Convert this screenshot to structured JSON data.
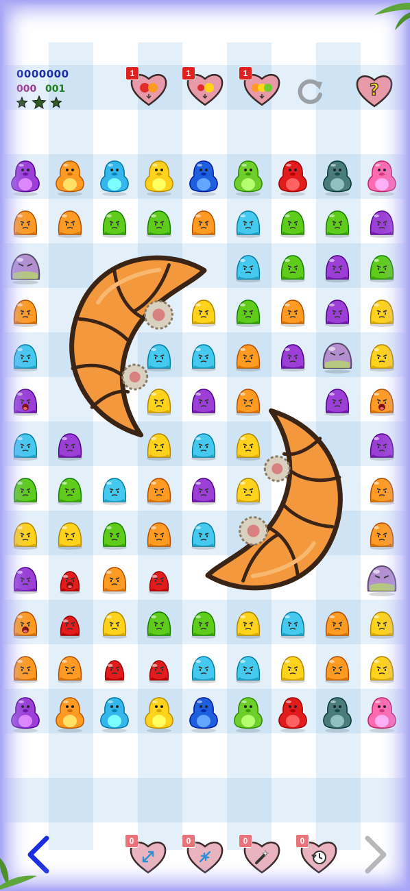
{
  "hud": {
    "score": "0000000",
    "moves": "000",
    "goal": "001",
    "stars": 3,
    "colors": {
      "score": "#1c2ca8",
      "moves": "#9a3a8a",
      "goal": "#1e7d1e",
      "star": "#2f5a22"
    }
  },
  "powerups": [
    {
      "name": "two-blob-combo",
      "count": "1",
      "blobs": [
        "red",
        "orange"
      ]
    },
    {
      "name": "two-blob-combo-2",
      "count": "1",
      "blobs": [
        "red",
        "yellow"
      ]
    },
    {
      "name": "three-blob-combo",
      "count": "1",
      "blobs": [
        "orange",
        "yellow",
        "green"
      ]
    }
  ],
  "controls": {
    "restart_icon": "refresh-icon",
    "help_label": "?"
  },
  "boosters": [
    {
      "name": "expand-booster",
      "count": "0",
      "icon": "expand-arrows-icon"
    },
    {
      "name": "shrink-booster",
      "count": "0",
      "icon": "shrink-arrows-icon"
    },
    {
      "name": "magic-wand-booster",
      "count": "0",
      "icon": "magic-wand-icon"
    },
    {
      "name": "undo-booster",
      "count": "0",
      "icon": "undo-clock-icon"
    }
  ],
  "nav": {
    "prev_icon": "chevron-left-icon",
    "next_icon": "chevron-right-icon",
    "prev_color": "#1a2ee0",
    "next_color": "#b8b8b8"
  },
  "palette": {
    "purple": "#9b3fd6",
    "orange": "#ff9b22",
    "cyan": "#36b7ec",
    "yellow": "#ffd21c",
    "blue": "#1e5fe0",
    "green": "#6fcf2a",
    "red": "#e21c1c",
    "teal": "#4b7c7c",
    "pink": "#ff6ab0",
    "lime": "#5fcc1c",
    "lightblue": "#46c9ee",
    "bubble": "#b48fd0"
  },
  "grid": {
    "penguin_rows": [
      [
        "purple",
        "orange",
        "cyan",
        "yellow",
        "blue",
        "green",
        "red",
        "teal",
        "pink"
      ],
      [
        "purple",
        "orange",
        "cyan",
        "yellow",
        "blue",
        "green",
        "red",
        "teal",
        "pink"
      ]
    ],
    "blobs": [
      [
        "orange",
        "orange",
        "lime",
        "lime",
        "orange",
        "lightblue",
        "lime",
        "lime",
        "purple"
      ],
      [
        "bubble",
        null,
        null,
        null,
        null,
        "lightblue",
        "lime",
        "purple",
        "lime"
      ],
      [
        "orange",
        null,
        null,
        null,
        "yellow",
        "lime",
        "orange",
        "purple",
        "yellow"
      ],
      [
        "lightblue",
        null,
        null,
        "lightblue",
        "lightblue",
        "orange",
        "purple",
        "bubble",
        "yellow"
      ],
      [
        "purple-scared",
        null,
        null,
        "yellow",
        "purple",
        "orange",
        null,
        "purple",
        "orange-scared"
      ],
      [
        "lightblue",
        "purple",
        null,
        "yellow",
        "lightblue",
        "yellow",
        null,
        null,
        "purple"
      ],
      [
        "lime",
        "lime",
        "lightblue",
        "orange",
        "purple",
        "yellow",
        null,
        null,
        "orange"
      ],
      [
        "yellow",
        "yellow",
        "lime",
        "orange",
        "lightblue",
        null,
        null,
        null,
        "orange"
      ],
      [
        "purple",
        "red-small-scared",
        "orange",
        "red-small",
        null,
        null,
        null,
        null,
        "bubble"
      ],
      [
        "orange-scared",
        "red-small",
        "yellow",
        "lime",
        "lime",
        "yellow",
        "lightblue",
        "orange",
        "yellow"
      ],
      [
        "orange",
        "orange",
        "red-small",
        "red-small",
        "lightblue",
        "lightblue",
        "yellow",
        "orange",
        "yellow"
      ]
    ]
  }
}
